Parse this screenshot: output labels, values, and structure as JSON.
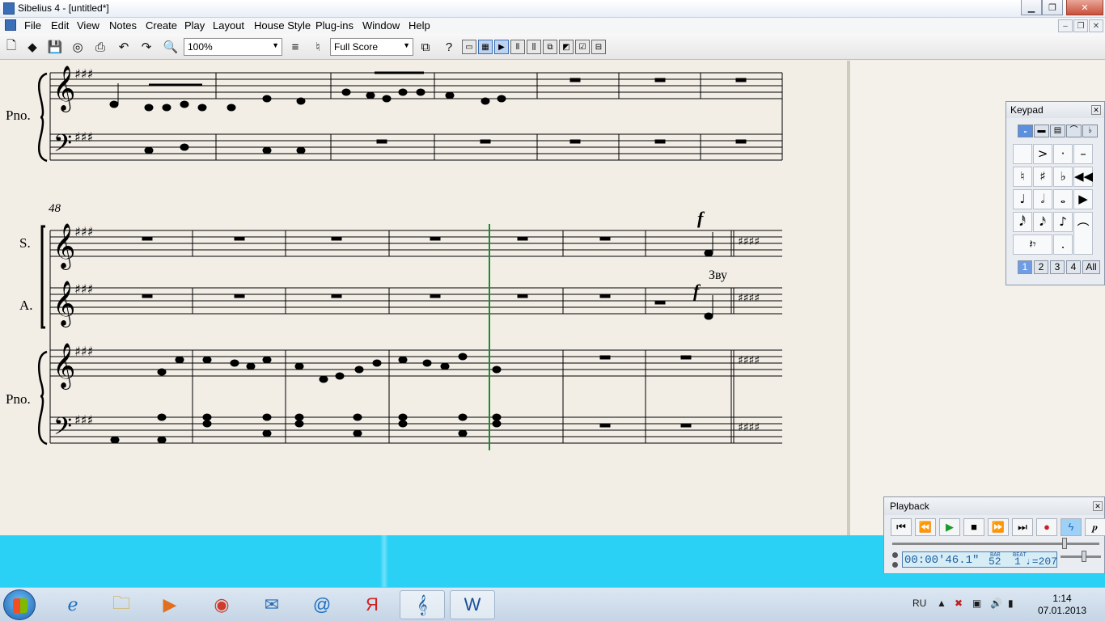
{
  "window": {
    "title": "Sibelius 4 - [untitled*]"
  },
  "menu": [
    "File",
    "Edit",
    "View",
    "Notes",
    "Create",
    "Play",
    "Layout",
    "House Style",
    "Plug-ins",
    "Window",
    "Help"
  ],
  "toolbar": {
    "zoom": "100%",
    "part": "Full Score"
  },
  "score": {
    "labels": {
      "piano": "Pno.",
      "soprano": "S.",
      "alto": "A."
    },
    "bar_number": "48",
    "dynamic": "f",
    "lyric": "Зву"
  },
  "keypad": {
    "title": "Keypad",
    "layouts": [
      "1",
      "2",
      "3",
      "4",
      "All"
    ]
  },
  "playback": {
    "title": "Playback",
    "time": "00:00'46.1\"",
    "bar_label": "BAR",
    "bar": "52",
    "beat_label": "BEAT",
    "beat": "1",
    "tempo": "♩=207"
  },
  "taskbar": {
    "lang": "RU",
    "time": "1:14",
    "date": "07.01.2013"
  }
}
